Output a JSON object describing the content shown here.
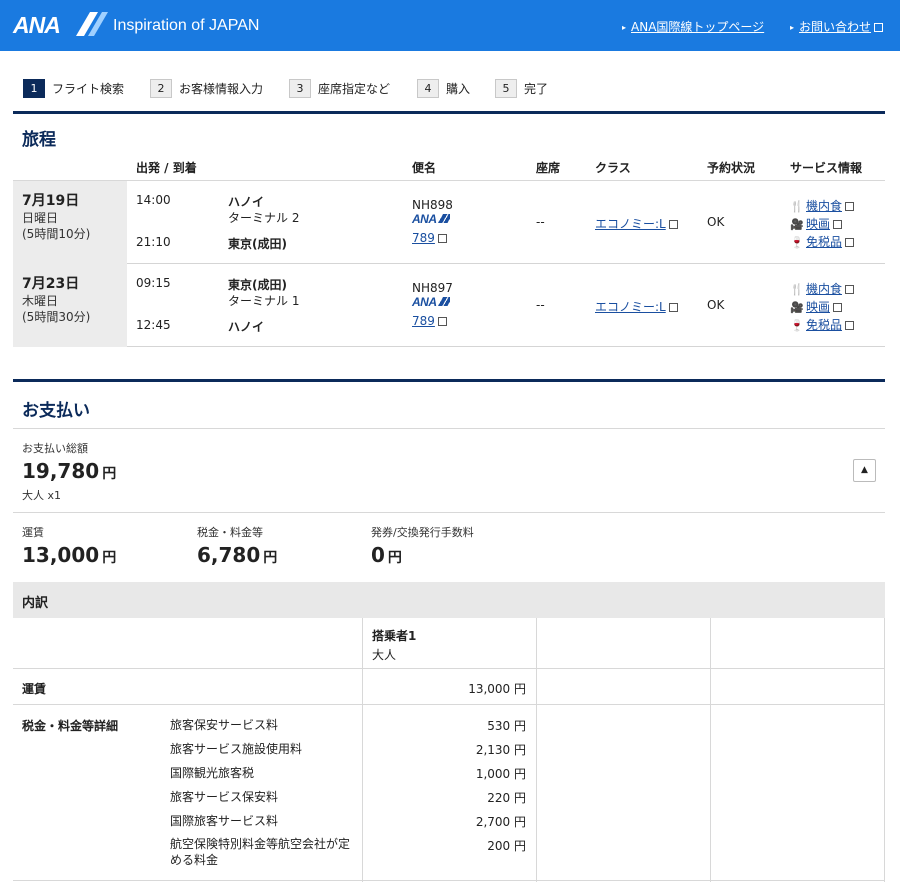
{
  "header": {
    "logo": "ANA",
    "tagline": "Inspiration of JAPAN",
    "links": [
      "ANA国際線トップページ",
      "お問い合わせ"
    ]
  },
  "steps": [
    {
      "num": "1",
      "label": "フライト検索"
    },
    {
      "num": "2",
      "label": "お客様情報入力"
    },
    {
      "num": "3",
      "label": "座席指定など"
    },
    {
      "num": "4",
      "label": "購入"
    },
    {
      "num": "5",
      "label": "完了"
    }
  ],
  "itinerary": {
    "title": "旅程",
    "columns": [
      "出発 / 到着",
      "便名",
      "座席",
      "クラス",
      "予約状況",
      "サービス情報"
    ],
    "flights": [
      {
        "date": "7月19日",
        "weekday": "日曜日",
        "duration": "(5時間10分)",
        "dep_time": "14:00",
        "dep_city": "ハノイ",
        "dep_terminal": "ターミナル 2",
        "arr_time": "21:10",
        "arr_city": "東京(成田)",
        "flight_no": "NH898",
        "airline": "ANA",
        "aircraft": "789",
        "seat": "--",
        "class": "エコノミー:L",
        "status": "OK",
        "services": [
          "機内食",
          "映画",
          "免税品"
        ]
      },
      {
        "date": "7月23日",
        "weekday": "木曜日",
        "duration": "(5時間30分)",
        "dep_time": "09:15",
        "dep_city": "東京(成田)",
        "dep_terminal": "ターミナル 1",
        "arr_time": "12:45",
        "arr_city": "ハノイ",
        "flight_no": "NH897",
        "airline": "ANA",
        "aircraft": "789",
        "seat": "--",
        "class": "エコノミー:L",
        "status": "OK",
        "services": [
          "機内食",
          "映画",
          "免税品"
        ]
      }
    ]
  },
  "payment": {
    "title": "お支払い",
    "total_label": "お支払い総額",
    "total": "19,780",
    "yen": "円",
    "pax": "大人 x1",
    "fare_label": "運賃",
    "fare": "13,000",
    "tax_label": "税金・料金等",
    "tax": "6,780",
    "fee_label": "発券/交換発行手数料",
    "fee": "0",
    "breakdown_title": "内訳",
    "passenger_label": "搭乗者1",
    "passenger_type": "大人",
    "fare_row_label": "運賃",
    "fare_row_amount": "13,000 円",
    "tax_detail_label": "税金・料金等詳細",
    "tax_items": [
      {
        "name": "旅客保安サービス料",
        "amount": "530 円"
      },
      {
        "name": "旅客サービス施設使用料",
        "amount": "2,130 円"
      },
      {
        "name": "国際観光旅客税",
        "amount": "1,000 円"
      },
      {
        "name": "旅客サービス保安料",
        "amount": "220 円"
      },
      {
        "name": "国際旅客サービス料",
        "amount": "2,700 円"
      },
      {
        "name": "航空保険特別料金等航空会社が定める料金",
        "amount": "200 円"
      }
    ]
  }
}
